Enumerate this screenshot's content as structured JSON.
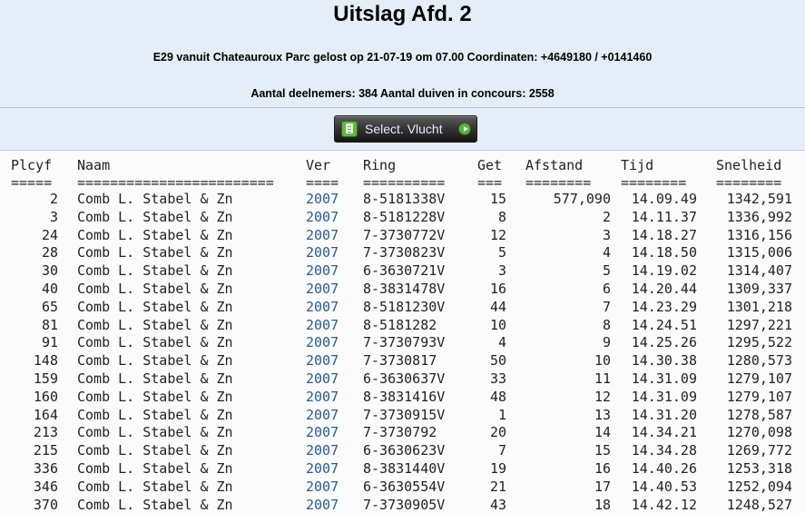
{
  "header": {
    "title": "Uitslag Afd. 2",
    "subtitle": "E29 vanuit Chateauroux Parc gelost op 21-07-19 om 07.00 Coordinaten: +4649180 / +0141460",
    "participants": "Aantal deelnemers: 384 Aantal duiven in concours: 2558"
  },
  "toolbar": {
    "select_label": "Select. Vlucht",
    "left_icon": "list-icon",
    "right_icon": "arrow-right-icon"
  },
  "table": {
    "columns": [
      "Plcyf",
      "Naam",
      "Ver",
      "Ring",
      "Get",
      "Afstand",
      "Tijd",
      "Snelheid"
    ],
    "separators": [
      "=====",
      "========================",
      "====",
      "==========",
      "===",
      "========",
      "========",
      "========"
    ],
    "rows": [
      [
        "2",
        "Comb L. Stabel & Zn",
        "2007",
        "8-5181338V",
        "15",
        "577,090",
        "14.09.49",
        "1342,591"
      ],
      [
        "3",
        "Comb L. Stabel & Zn",
        "2007",
        "8-5181228V",
        "8",
        "2",
        "14.11.37",
        "1336,992"
      ],
      [
        "24",
        "Comb L. Stabel & Zn",
        "2007",
        "7-3730772V",
        "12",
        "3",
        "14.18.27",
        "1316,156"
      ],
      [
        "28",
        "Comb L. Stabel & Zn",
        "2007",
        "7-3730823V",
        "5",
        "4",
        "14.18.50",
        "1315,006"
      ],
      [
        "30",
        "Comb L. Stabel & Zn",
        "2007",
        "6-3630721V",
        "3",
        "5",
        "14.19.02",
        "1314,407"
      ],
      [
        "40",
        "Comb L. Stabel & Zn",
        "2007",
        "8-3831478V",
        "16",
        "6",
        "14.20.44",
        "1309,337"
      ],
      [
        "65",
        "Comb L. Stabel & Zn",
        "2007",
        "8-5181230V",
        "44",
        "7",
        "14.23.29",
        "1301,218"
      ],
      [
        "81",
        "Comb L. Stabel & Zn",
        "2007",
        "8-5181282",
        "10",
        "8",
        "14.24.51",
        "1297,221"
      ],
      [
        "91",
        "Comb L. Stabel & Zn",
        "2007",
        "7-3730793V",
        "4",
        "9",
        "14.25.26",
        "1295,522"
      ],
      [
        "148",
        "Comb L. Stabel & Zn",
        "2007",
        "7-3730817",
        "50",
        "10",
        "14.30.38",
        "1280,573"
      ],
      [
        "159",
        "Comb L. Stabel & Zn",
        "2007",
        "6-3630637V",
        "33",
        "11",
        "14.31.09",
        "1279,107"
      ],
      [
        "160",
        "Comb L. Stabel & Zn",
        "2007",
        "8-3831416V",
        "48",
        "12",
        "14.31.09",
        "1279,107"
      ],
      [
        "164",
        "Comb L. Stabel & Zn",
        "2007",
        "7-3730915V",
        "1",
        "13",
        "14.31.20",
        "1278,587"
      ],
      [
        "213",
        "Comb L. Stabel & Zn",
        "2007",
        "7-3730792",
        "20",
        "14",
        "14.34.21",
        "1270,098"
      ],
      [
        "215",
        "Comb L. Stabel & Zn",
        "2007",
        "6-3630623V",
        "7",
        "15",
        "14.34.28",
        "1269,772"
      ],
      [
        "336",
        "Comb L. Stabel & Zn",
        "2007",
        "8-3831440V",
        "19",
        "16",
        "14.40.26",
        "1253,318"
      ],
      [
        "346",
        "Comb L. Stabel & Zn",
        "2007",
        "6-3630554V",
        "21",
        "17",
        "14.40.53",
        "1252,094"
      ],
      [
        "370",
        "Comb L. Stabel & Zn",
        "2007",
        "7-3730905V",
        "43",
        "18",
        "14.42.12",
        "1248,527"
      ]
    ]
  }
}
